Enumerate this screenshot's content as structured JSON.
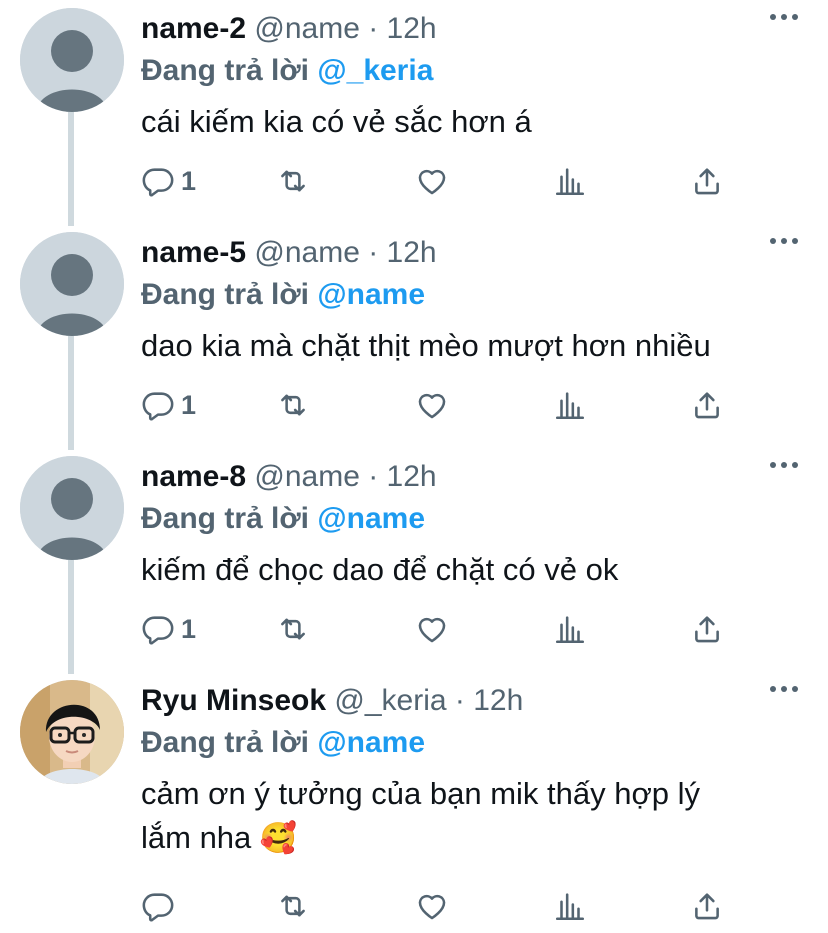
{
  "tweets": [
    {
      "name": "name-2",
      "handle": "@name",
      "time": "· 12h",
      "replying_label": "Đang trả lời",
      "replying_to": "@_keria",
      "text": "cái kiếm kia có vẻ sắc hơn á",
      "reply_count": "1",
      "avatar": "default-avatar-icon"
    },
    {
      "name": "name-5",
      "handle": "@name",
      "time": "· 12h",
      "replying_label": "Đang trả lời",
      "replying_to": "@name",
      "text": "dao kia mà chặt thịt mèo mượt hơn nhiều",
      "reply_count": "1",
      "avatar": "default-avatar-icon"
    },
    {
      "name": "name-8",
      "handle": "@name",
      "time": "· 12h",
      "replying_label": "Đang trả lời",
      "replying_to": "@name",
      "text": "kiếm để chọc dao để chặt có vẻ ok",
      "reply_count": "1",
      "avatar": "default-avatar-icon"
    },
    {
      "name": "Ryu Minseok",
      "handle": "@_keria",
      "time": "· 12h",
      "replying_label": "Đang trả lời",
      "replying_to": "@name",
      "text_line1": "cảm ơn ý tưởng của bạn mik thấy hợp lý",
      "text_line2": "lắm nha",
      "emoji": "🥰",
      "reply_count": "",
      "avatar": "profile-photo"
    }
  ],
  "icons": {
    "reply": "reply-icon",
    "retweet": "retweet-icon",
    "like": "heart-icon",
    "analytics": "analytics-icon",
    "share": "share-icon",
    "more": "more-dots-icon"
  },
  "colors": {
    "link": "#1d9bf0",
    "secondary": "#536471",
    "text": "#0f1419",
    "thread_line": "#cfd9de",
    "avatar_bg": "#ccd6dd",
    "avatar_fg": "#66757f"
  }
}
